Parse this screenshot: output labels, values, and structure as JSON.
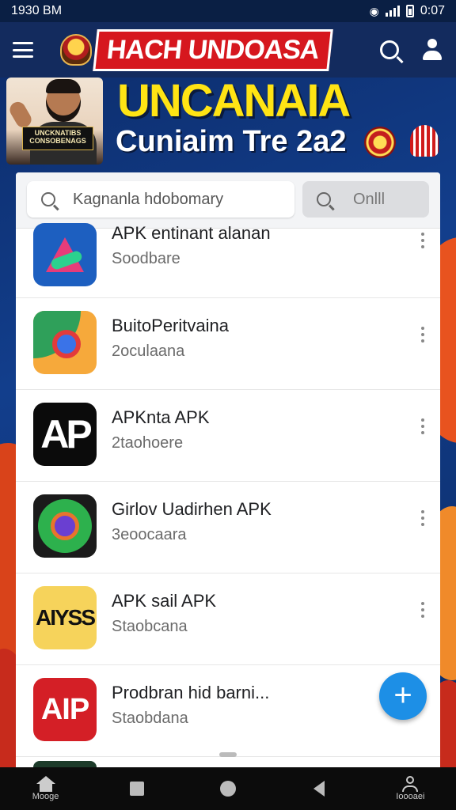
{
  "status_bar": {
    "time": "1930 BM",
    "right_time": "0:07"
  },
  "app_bar": {
    "title": "HACH UNDOASA"
  },
  "banner": {
    "title": "UNCANAIA",
    "subtitle": "Cuniaim Tre 2a2",
    "portrait_plate": "UNCKNATIBS CONSOBENAGS"
  },
  "search": {
    "placeholder": "Kagnanla hdobomary",
    "secondary": "Onlll"
  },
  "apps": [
    {
      "title": "APK entinant alanan",
      "subtitle": "Soodbare",
      "icon": "app-icon-a",
      "icon_text": ""
    },
    {
      "title": "BuitoPeritvaina",
      "subtitle": "2oculaana",
      "icon": "app-icon-maps",
      "icon_text": ""
    },
    {
      "title": "APKnta APK",
      "subtitle": "2taohoere",
      "icon": "app-icon-ap",
      "icon_text": "AP"
    },
    {
      "title": "Girlov Uadirhen APK",
      "subtitle": "3eoocaara",
      "icon": "app-icon-globe",
      "icon_text": ""
    },
    {
      "title": "APK sail APK",
      "subtitle": "Staobcana",
      "icon": "app-icon-ayss",
      "icon_text": "AIYSS"
    },
    {
      "title": "Prodbran hid barni...",
      "subtitle": "Staobdana",
      "icon": "app-icon-aip",
      "icon_text": "AIP"
    }
  ],
  "fab": {
    "label": "+"
  },
  "bottom_nav": {
    "home_label": "Mooge",
    "profile_label": "Ioooaei"
  },
  "colors": {
    "brand_red": "#d6171e",
    "banner_yellow": "#ffe414",
    "fab_blue": "#1d8fe6",
    "app_bar": "#132b5e"
  }
}
